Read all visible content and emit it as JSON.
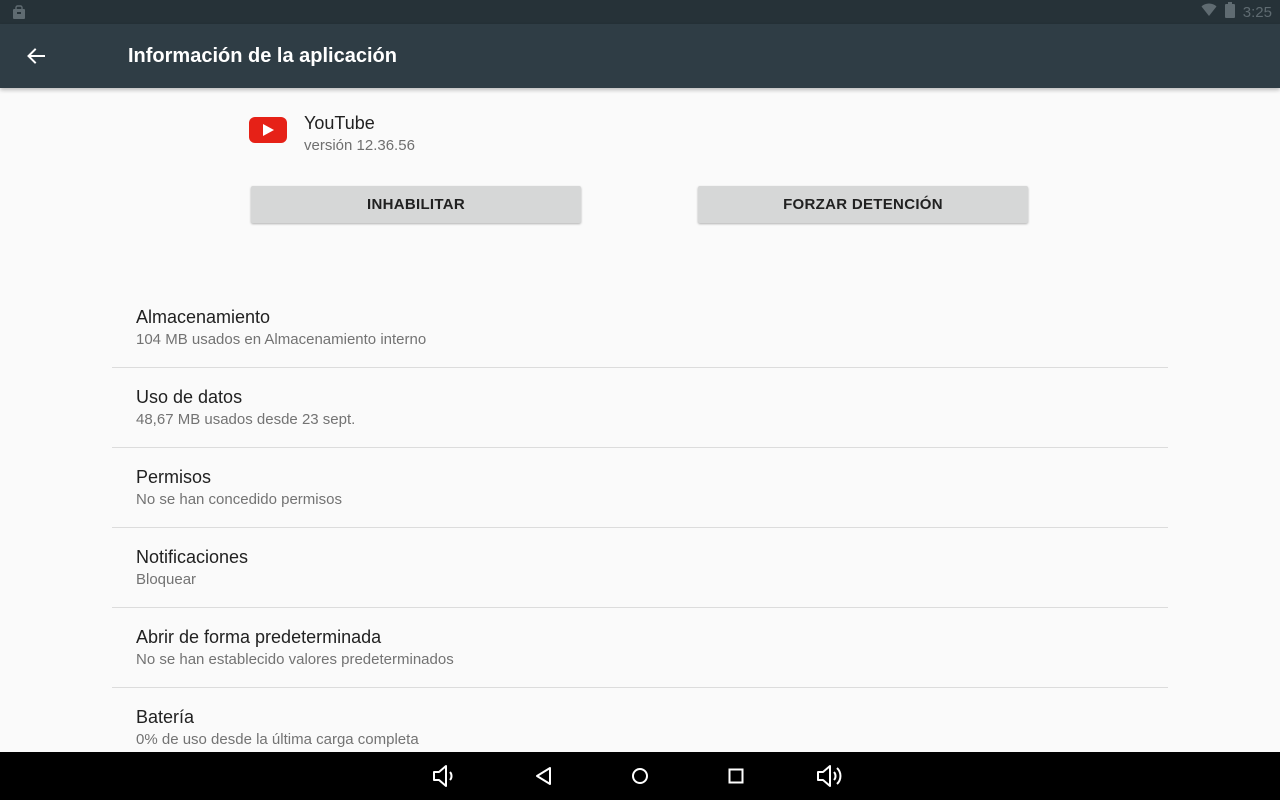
{
  "status_bar": {
    "time": "3:25"
  },
  "app_bar": {
    "title": "Información de la aplicación"
  },
  "app": {
    "name": "YouTube",
    "version": "versión 12.36.56",
    "icon_color": "#e62117"
  },
  "actions": {
    "disable_label": "INHABILITAR",
    "force_stop_label": "FORZAR DETENCIÓN"
  },
  "settings": [
    {
      "title": "Almacenamiento",
      "subtitle": "104 MB usados en Almacenamiento interno"
    },
    {
      "title": "Uso de datos",
      "subtitle": "48,67 MB usados desde 23 sept."
    },
    {
      "title": "Permisos",
      "subtitle": "No se han concedido permisos"
    },
    {
      "title": "Notificaciones",
      "subtitle": "Bloquear"
    },
    {
      "title": "Abrir de forma predeterminada",
      "subtitle": "No se han establecido valores predeterminados"
    },
    {
      "title": "Batería",
      "subtitle": "0% de uso desde la última carga completa"
    }
  ],
  "nav_bar": {
    "icons": [
      "volume-down-icon",
      "back-triangle-icon",
      "home-circle-icon",
      "recents-square-icon",
      "volume-up-icon"
    ]
  }
}
